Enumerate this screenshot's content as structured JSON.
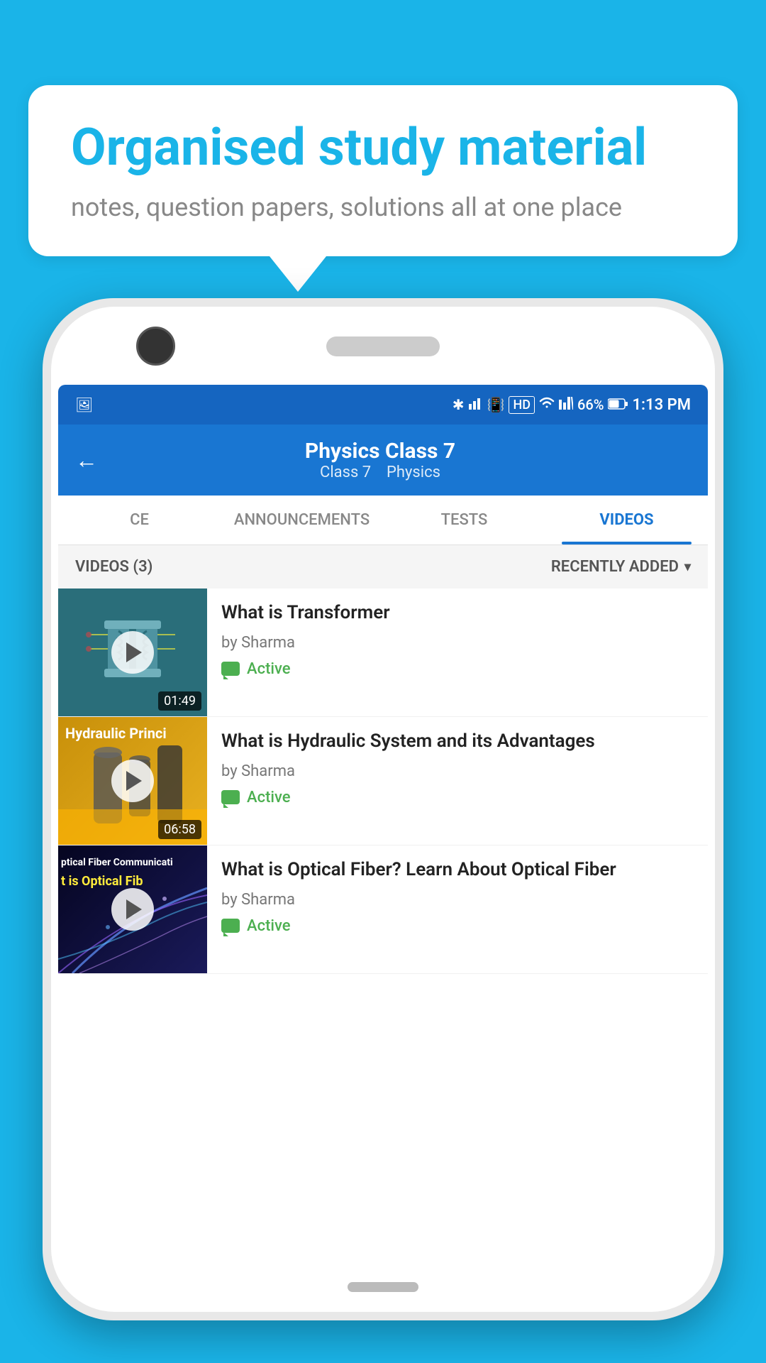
{
  "page": {
    "background_color": "#1ab4e8"
  },
  "speech_bubble": {
    "heading": "Organised study material",
    "subtext": "notes, question papers, solutions all at one place"
  },
  "status_bar": {
    "time": "1:13 PM",
    "battery": "66%",
    "signal_strength": "HD"
  },
  "header": {
    "title": "Physics Class 7",
    "subtitle_class": "Class 7",
    "subtitle_subject": "Physics",
    "back_label": "←"
  },
  "tabs": [
    {
      "id": "ce",
      "label": "CE",
      "active": false
    },
    {
      "id": "announcements",
      "label": "ANNOUNCEMENTS",
      "active": false
    },
    {
      "id": "tests",
      "label": "TESTS",
      "active": false
    },
    {
      "id": "videos",
      "label": "VIDEOS",
      "active": true
    }
  ],
  "videos_section": {
    "header_label": "VIDEOS (3)",
    "sort_label": "RECENTLY ADDED"
  },
  "videos": [
    {
      "id": 1,
      "title": "What is  Transformer",
      "author": "by Sharma",
      "status": "Active",
      "duration": "01:49",
      "thumbnail_type": "transformer"
    },
    {
      "id": 2,
      "title": "What is Hydraulic System and its Advantages",
      "author": "by Sharma",
      "status": "Active",
      "duration": "06:58",
      "thumbnail_type": "hydraulic",
      "thumbnail_text": "Hydraulic Princi"
    },
    {
      "id": 3,
      "title": "What is Optical Fiber? Learn About Optical Fiber",
      "author": "by Sharma",
      "status": "Active",
      "duration": "",
      "thumbnail_type": "optical",
      "thumbnail_text": "ptical Fiber Communicati",
      "thumbnail_subtext": "t is Optical Fib"
    }
  ],
  "icons": {
    "play": "▶",
    "back": "←",
    "chevron_down": "▾",
    "chat": "💬",
    "active_label": "Active"
  }
}
